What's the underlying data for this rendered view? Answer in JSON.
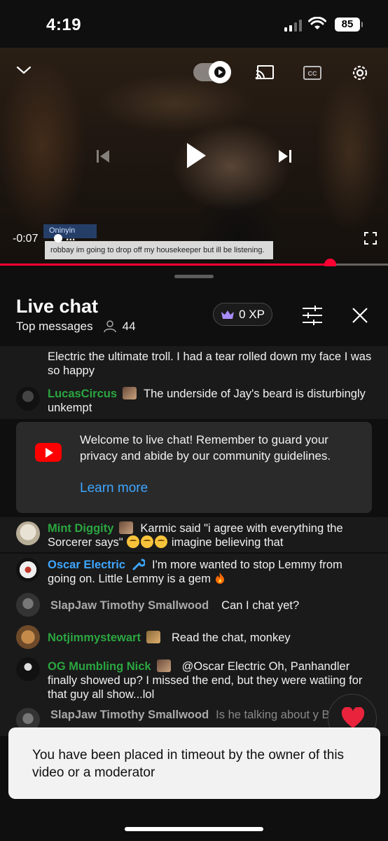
{
  "status_bar": {
    "time": "4:19",
    "battery": "85"
  },
  "video": {
    "overlay_card_name": "Oninyin",
    "overlay_message": "robbay im going to drop off my housekeeper but ill be listening.",
    "remaining_time": "-0:07",
    "dots": "...",
    "progress": 0.85,
    "icons": [
      "chevron-down-icon",
      "autoplay-toggle",
      "cast-icon",
      "captions-icon",
      "settings-icon",
      "previous-icon",
      "play-icon",
      "next-icon",
      "fullscreen-icon"
    ]
  },
  "chat": {
    "title": "Live chat",
    "mode": "Top messages",
    "viewer_count": "44",
    "xp": "0 XP",
    "messages": [
      {
        "author": "",
        "text": "Electric the ultimate troll. I had a tear rolled down my face I was so happy"
      },
      {
        "author": "LucasCircus",
        "text": "The underside of Jay's beard is disturbingly unkempt"
      },
      {
        "author": "Mint Diggity",
        "text_before": "Karmic said \"i agree with everything the Sorcerer says\"",
        "text_after": "imagine believing that"
      },
      {
        "author": "Oscar Electric",
        "text": "I'm more wanted to stop Lemmy from going on. Little Lemmy is a gem"
      },
      {
        "author": "SlapJaw Timothy Smallwood",
        "text": "Can I chat yet?"
      },
      {
        "author": "Notjimmystewart",
        "text": "Read the chat, monkey"
      },
      {
        "author": "OG Mumbling Nick",
        "text": "@Oscar Electric Oh, Panhandler finally showed up? I missed the end, but they were watiing for that guy all show...lol"
      },
      {
        "author": "SlapJaw Timothy Smallwood",
        "text": "Is he talking about y Bob?"
      }
    ],
    "welcome": {
      "text": "Welcome to live chat! Remember to guard your privacy and abide by our community guidelines.",
      "link": "Learn more"
    }
  },
  "toast": {
    "text": "You have been placed in timeout by the owner of this video or a moderator"
  },
  "colors": {
    "accent_red": "#ff0033",
    "link_blue": "#3ea6ff",
    "member_green": "#2ba640"
  }
}
